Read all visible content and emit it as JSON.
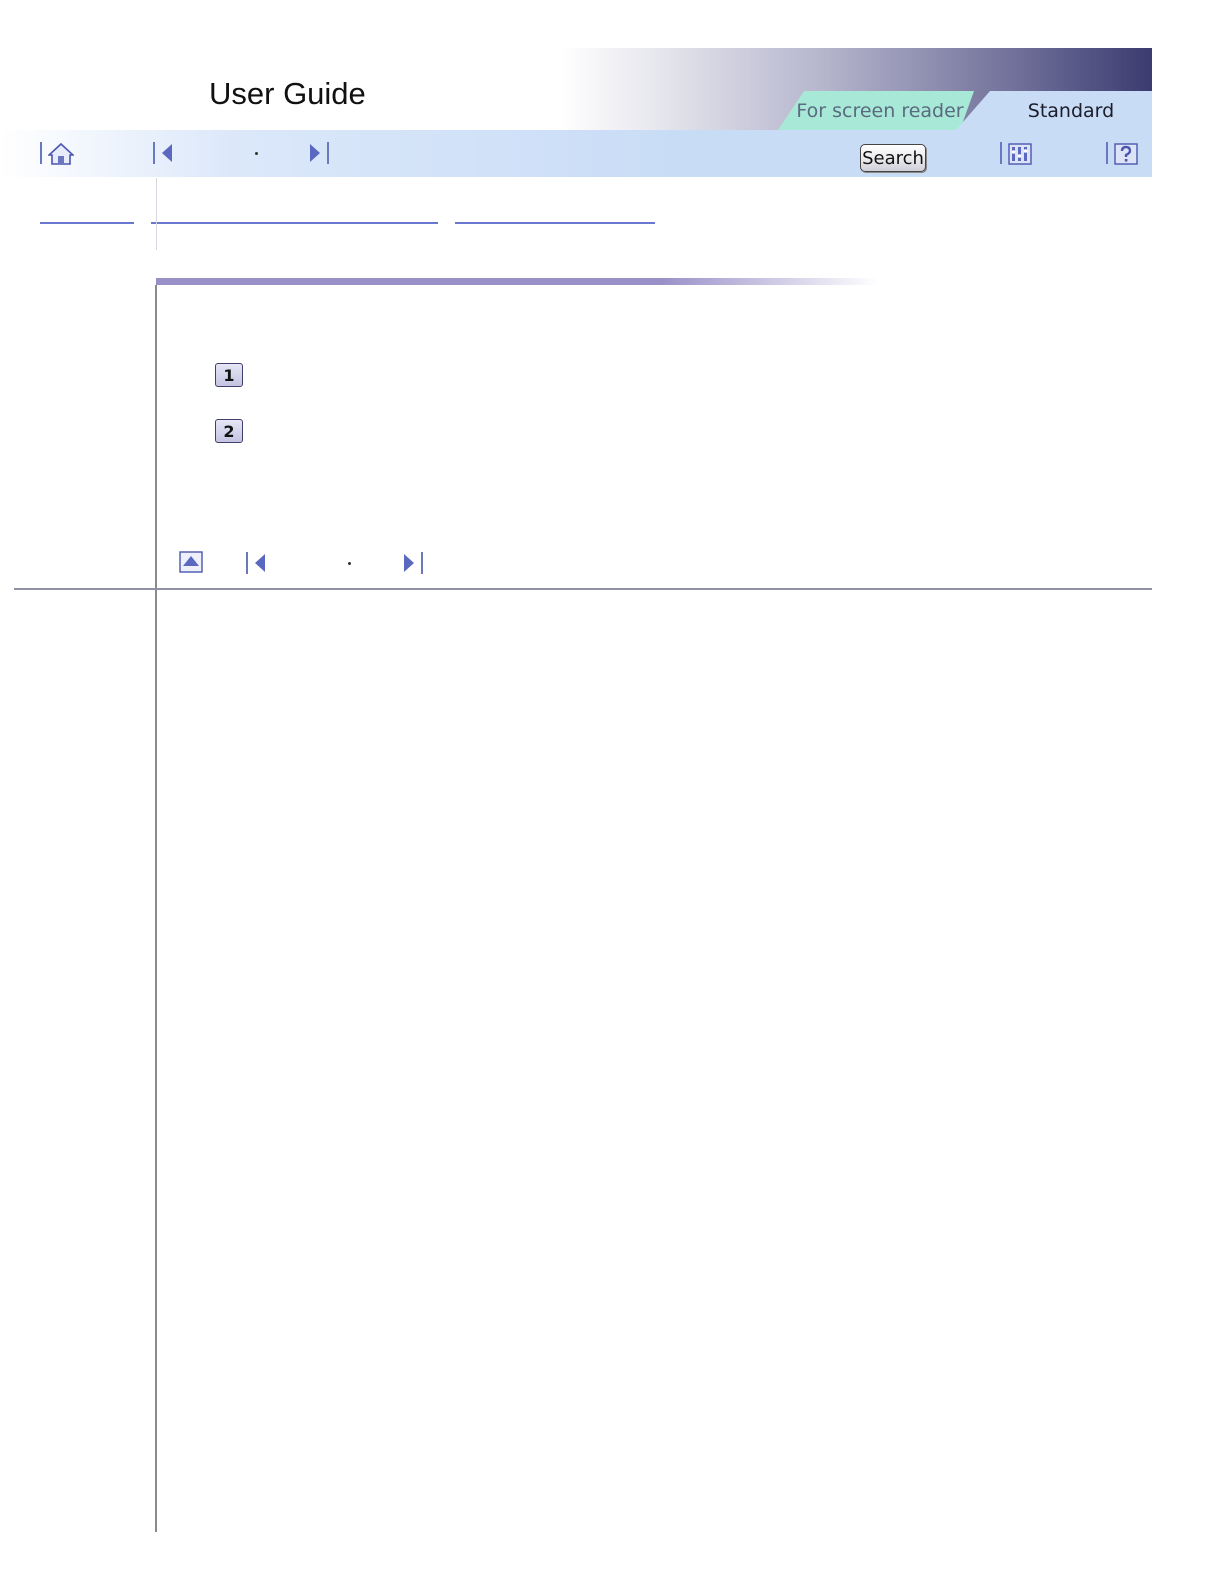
{
  "header": {
    "app_title": "User Guide",
    "tabs": [
      {
        "label": "For screen reader",
        "selected": false
      },
      {
        "label": "Standard",
        "selected": true
      }
    ],
    "search_label": "Search"
  },
  "steps": [
    {
      "number": "1"
    },
    {
      "number": "2"
    }
  ],
  "colors": {
    "toolbar": "#c8dcf6",
    "tab_screen_reader": "#a8e8d6",
    "accent": "#6a78c0",
    "title_bar": "#9a90c8"
  },
  "icons": {
    "home": "home-icon",
    "previous": "previous-icon",
    "next": "next-icon",
    "contents": "contents-icon",
    "help": "help-icon",
    "top": "back-to-top-icon"
  }
}
